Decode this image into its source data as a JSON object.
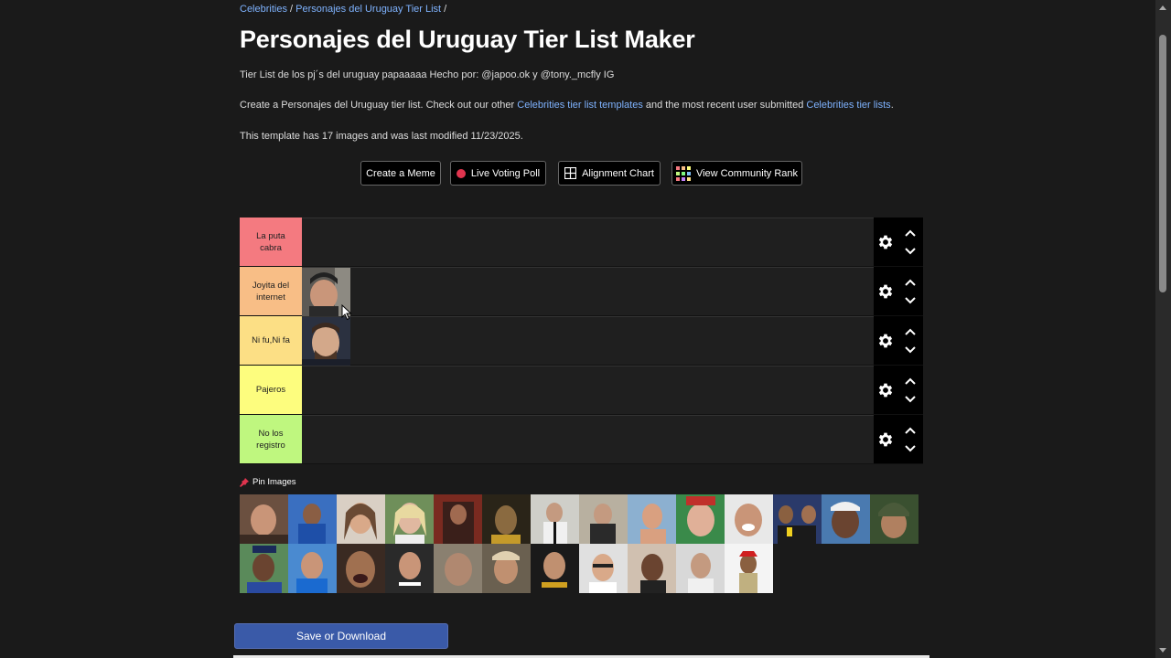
{
  "breadcrumb": {
    "celebrities": "Celebrities",
    "sep1": " / ",
    "current": "Personajes del Uruguay Tier List",
    "sep2": " /"
  },
  "page": {
    "title": "Personajes del Uruguay Tier List Maker",
    "description": "Tier List de los pj´s del uruguay papaaaaa Hecho por: @japoo.ok y @tony._mcfly IG",
    "create_text_1": "Create a Personajes del Uruguay tier list. Check out our other ",
    "create_link_1": "Celebrities tier list templates",
    "create_text_2": " and the most recent user submitted ",
    "create_link_2": "Celebrities tier lists",
    "create_text_3": ".",
    "template_info": "This template has 17 images and was last modified 11/23/2025."
  },
  "actions": {
    "create_meme": "Create a Meme",
    "live_poll": "Live Voting Poll",
    "alignment_chart": "Alignment Chart",
    "community_rank": "View Community Rank"
  },
  "tiers": [
    {
      "label": "La puta cabra",
      "color": "#f47a80"
    },
    {
      "label": "Joyita del internet",
      "color": "#f8be86"
    },
    {
      "label": "Ni fu,Ni fa",
      "color": "#fcdf85"
    },
    {
      "label": "Pajeros",
      "color": "#fdfd7e"
    },
    {
      "label": "No los registro",
      "color": "#bff77f"
    }
  ],
  "pin_images_label": "Pin Images",
  "save_button": "Save or Download"
}
